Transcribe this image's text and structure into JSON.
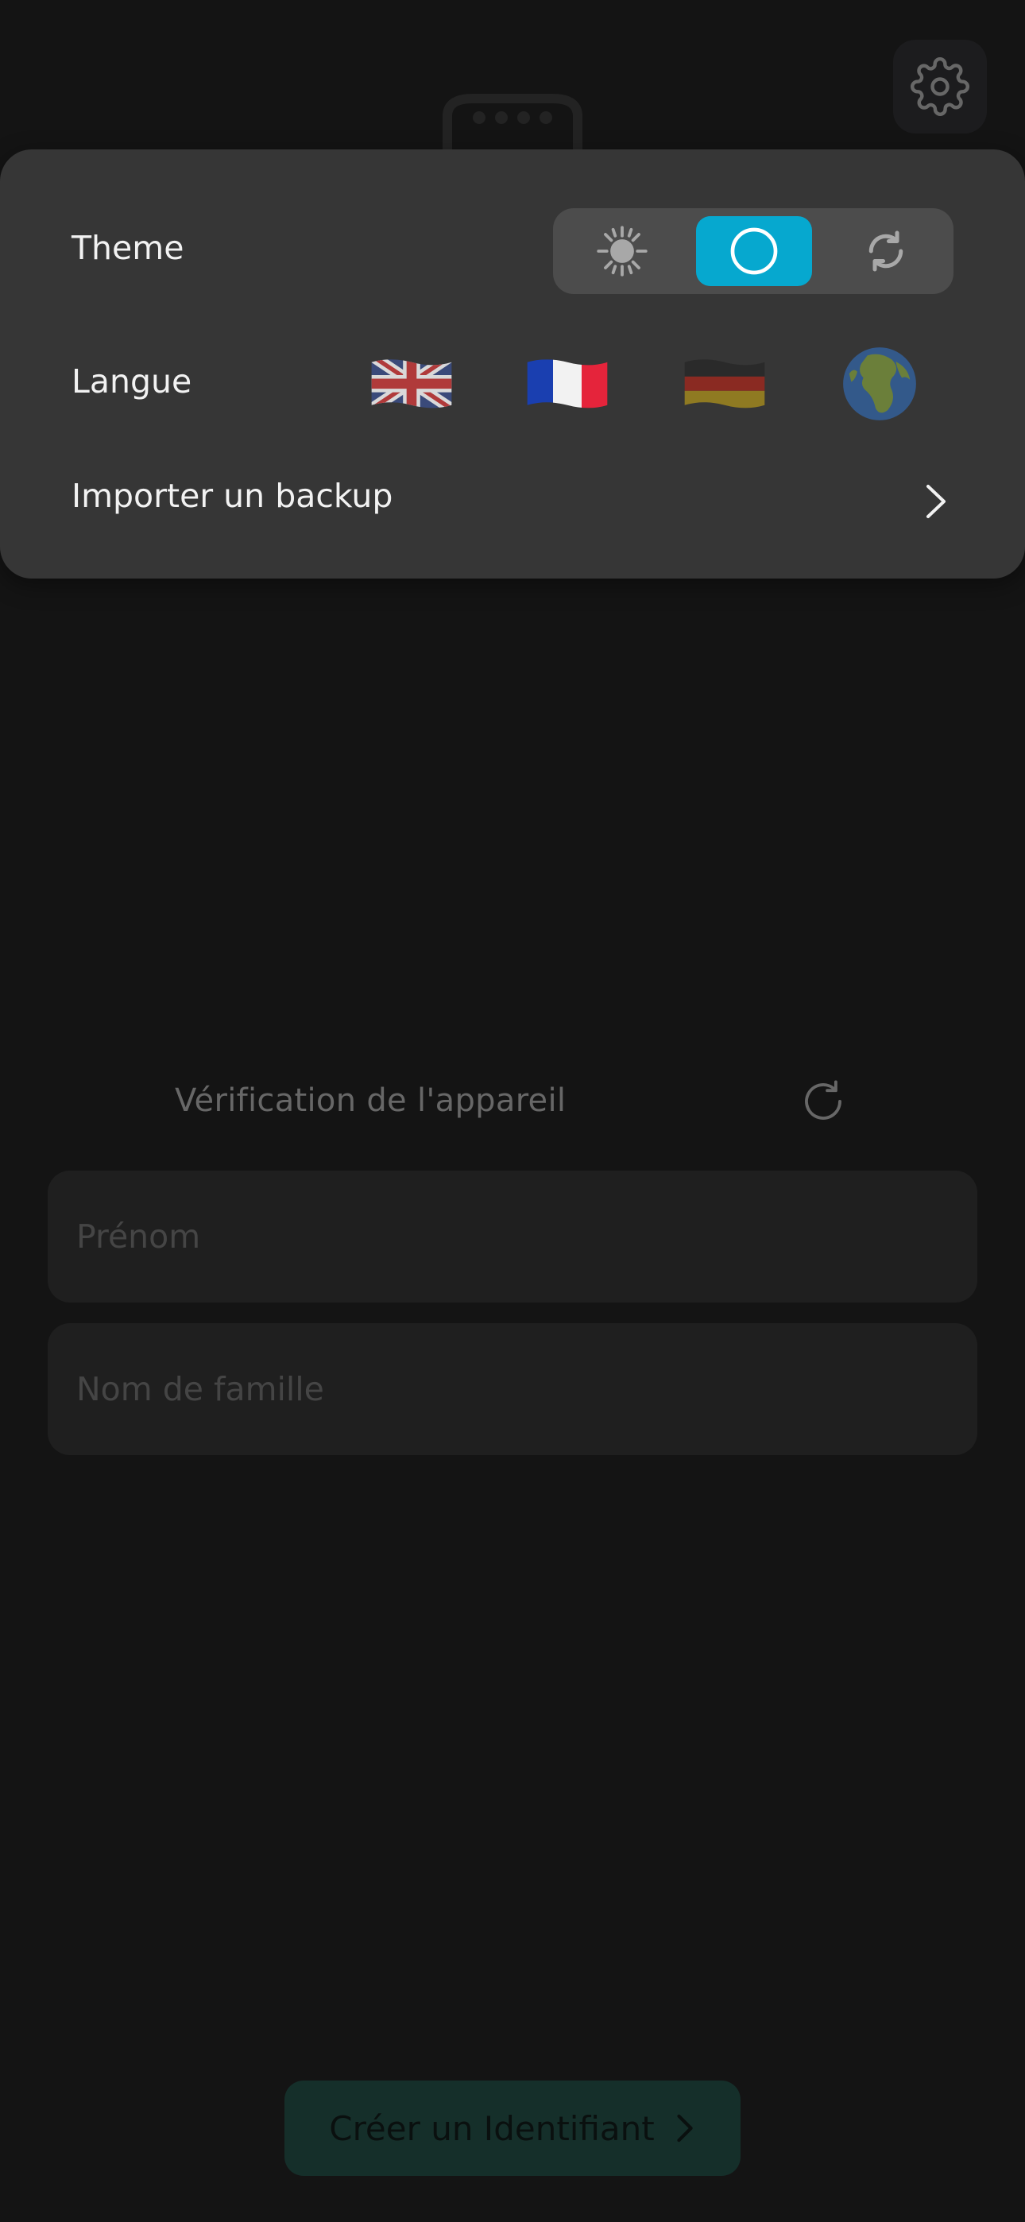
{
  "settings_panel": {
    "theme_label": "Theme",
    "theme_options": [
      "light",
      "dark",
      "auto"
    ],
    "theme_selected": "dark",
    "language_label": "Langue",
    "languages": [
      "English",
      "Français",
      "Deutsch",
      "Other"
    ],
    "import_label": "Importer un backup"
  },
  "verification": {
    "label": "Vérification de l'appareil"
  },
  "form": {
    "first_name_placeholder": "Prénom",
    "last_name_placeholder": "Nom de famille"
  },
  "cta": {
    "create_label": "Créer un Identifiant"
  },
  "colors": {
    "accent": "#06a8cf",
    "background": "#1b1b1b",
    "panel": "#363636",
    "button_green": "#1d3f39"
  },
  "icons": {
    "settings": "gear-icon",
    "refresh": "refresh-icon",
    "theme_light": "sun-icon",
    "theme_dark": "moon-icon",
    "theme_auto": "sync-icon",
    "import": "chevron-right-icon",
    "create": "chevron-right-icon"
  }
}
